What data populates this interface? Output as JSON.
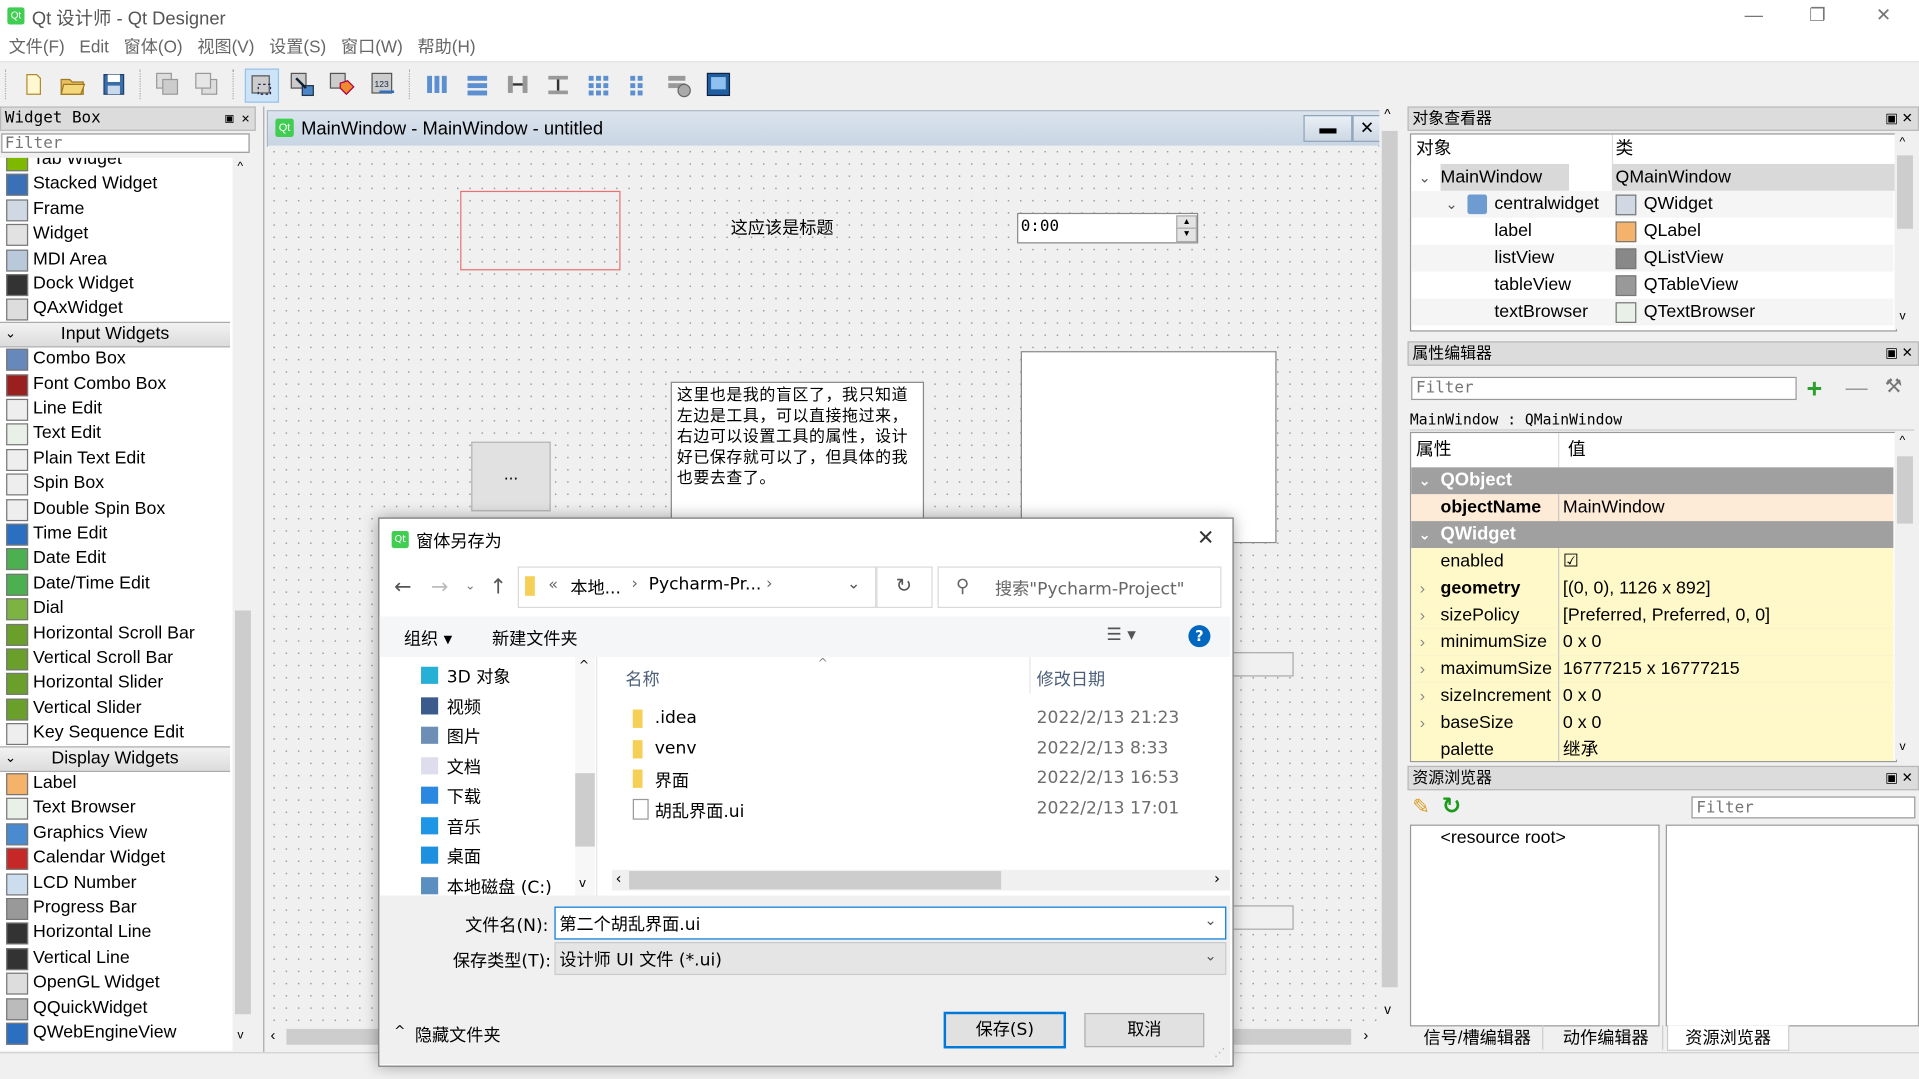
{
  "app": {
    "title": "Qt 设计师 - Qt Designer",
    "window_controls": {
      "minimize": "—",
      "restore": "❐",
      "close": "✕"
    }
  },
  "menubar": [
    "文件(F)",
    "Edit",
    "窗体(O)",
    "视图(V)",
    "设置(S)",
    "窗口(W)",
    "帮助(H)"
  ],
  "toolbar": {
    "buttons": [
      "new-file",
      "open-file",
      "save-file",
      "send-to-back",
      "bring-to-front",
      "edit-widgets",
      "edit-signals-slots",
      "edit-buddies",
      "edit-tab-order",
      "lay-out-horizontally",
      "lay-out-vertically",
      "lay-out-horizontal-splitter",
      "lay-out-vertical-splitter",
      "lay-out-grid",
      "lay-out-form",
      "break-layout",
      "adjust-size"
    ]
  },
  "widget_box": {
    "title": "Widget Box",
    "filter_placeholder": "Filter",
    "items_top": [
      "Tab Widget",
      "Stacked Widget",
      "Frame",
      "Widget",
      "MDI Area",
      "Dock Widget",
      "QAxWidget"
    ],
    "category_input": "Input Widgets",
    "input_items": [
      "Combo Box",
      "Font Combo Box",
      "Line Edit",
      "Text Edit",
      "Plain Text Edit",
      "Spin Box",
      "Double Spin Box",
      "Time Edit",
      "Date Edit",
      "Date/Time Edit",
      "Dial",
      "Horizontal Scroll Bar",
      "Vertical Scroll Bar",
      "Horizontal Slider",
      "Vertical Slider",
      "Key Sequence Edit"
    ],
    "category_display": "Display Widgets",
    "display_items": [
      "Label",
      "Text Browser",
      "Graphics View",
      "Calendar Widget",
      "LCD Number",
      "Progress Bar",
      "Horizontal Line",
      "Vertical Line",
      "OpenGL Widget",
      "QQuickWidget",
      "QWebEngineView"
    ]
  },
  "form": {
    "title": "MainWindow - MainWindow - untitled",
    "label_text": "这应该是标题",
    "time_edit_value": "0:00",
    "tool_button_text": "...",
    "text_browser_content": "这里也是我的盲区了，我只知道左边是工具，可以直接拖过来，右边可以设置工具的属性，设计好已保存就可以了，但具体的我也要去查了。"
  },
  "save_dialog": {
    "title": "窗体另存为",
    "breadcrumb": [
      "«",
      "本地...",
      "Pycharm-Pr..."
    ],
    "search_placeholder": "搜索\"Pycharm-Project\"",
    "organize_label": "组织 ▾",
    "new_folder_label": "新建文件夹",
    "nav_items": [
      "3D 对象",
      "视频",
      "图片",
      "文档",
      "下载",
      "音乐",
      "桌面",
      "本地磁盘 (C:)"
    ],
    "columns": {
      "name": "名称",
      "modified": "修改日期"
    },
    "files": [
      {
        "name": ".idea",
        "type": "folder",
        "modified": "2022/2/13 21:23"
      },
      {
        "name": "venv",
        "type": "folder",
        "modified": "2022/2/13 8:33"
      },
      {
        "name": "界面",
        "type": "folder",
        "modified": "2022/2/13 16:53"
      },
      {
        "name": "胡乱界面.ui",
        "type": "file",
        "modified": "2022/2/13 17:01"
      }
    ],
    "filename_label": "文件名(N):",
    "filename_value": "第二个胡乱界面.ui",
    "filetype_label": "保存类型(T):",
    "filetype_value": "设计师 UI 文件 (*.ui)",
    "hide_folders_label": "隐藏文件夹",
    "save_button": "保存(S)",
    "cancel_button": "取消"
  },
  "object_inspector": {
    "title": "对象查看器",
    "col_object": "对象",
    "col_class": "类",
    "rows": [
      {
        "object": "MainWindow",
        "class": "QMainWindow",
        "level": 0
      },
      {
        "object": "centralwidget",
        "class": "QWidget",
        "level": 1
      },
      {
        "object": "label",
        "class": "QLabel",
        "level": 2
      },
      {
        "object": "listView",
        "class": "QListView",
        "level": 2
      },
      {
        "object": "tableView",
        "class": "QTableView",
        "level": 2
      },
      {
        "object": "textBrowser",
        "class": "QTextBrowser",
        "level": 2
      }
    ]
  },
  "property_editor": {
    "title": "属性编辑器",
    "filter_placeholder": "Filter",
    "context": "MainWindow : QMainWindow",
    "col_property": "属性",
    "col_value": "值",
    "groups": [
      {
        "name": "QObject",
        "props": [
          {
            "k": "objectName",
            "v": "MainWindow",
            "bold": true
          }
        ]
      },
      {
        "name": "QWidget",
        "props": [
          {
            "k": "enabled",
            "v": "☑"
          },
          {
            "k": "geometry",
            "v": "[(0, 0), 1126 x 892]",
            "bold": true
          },
          {
            "k": "sizePolicy",
            "v": "[Preferred, Preferred, 0, 0]"
          },
          {
            "k": "minimumSize",
            "v": "0 x 0"
          },
          {
            "k": "maximumSize",
            "v": "16777215 x 16777215"
          },
          {
            "k": "sizeIncrement",
            "v": "0 x 0"
          },
          {
            "k": "baseSize",
            "v": "0 x 0"
          },
          {
            "k": "palette",
            "v": "继承"
          }
        ]
      }
    ]
  },
  "resource_browser": {
    "title": "资源浏览器",
    "filter_placeholder": "Filter",
    "root": "<resource root>"
  },
  "bottom_tabs": [
    "信号/槽编辑器",
    "动作编辑器",
    "资源浏览器"
  ],
  "colors": {
    "accent_blue": "#0067c0",
    "group_header": "#a0a0a0",
    "prop_highlight": "#fff8c8",
    "selected_row": "#d9d9d9"
  }
}
